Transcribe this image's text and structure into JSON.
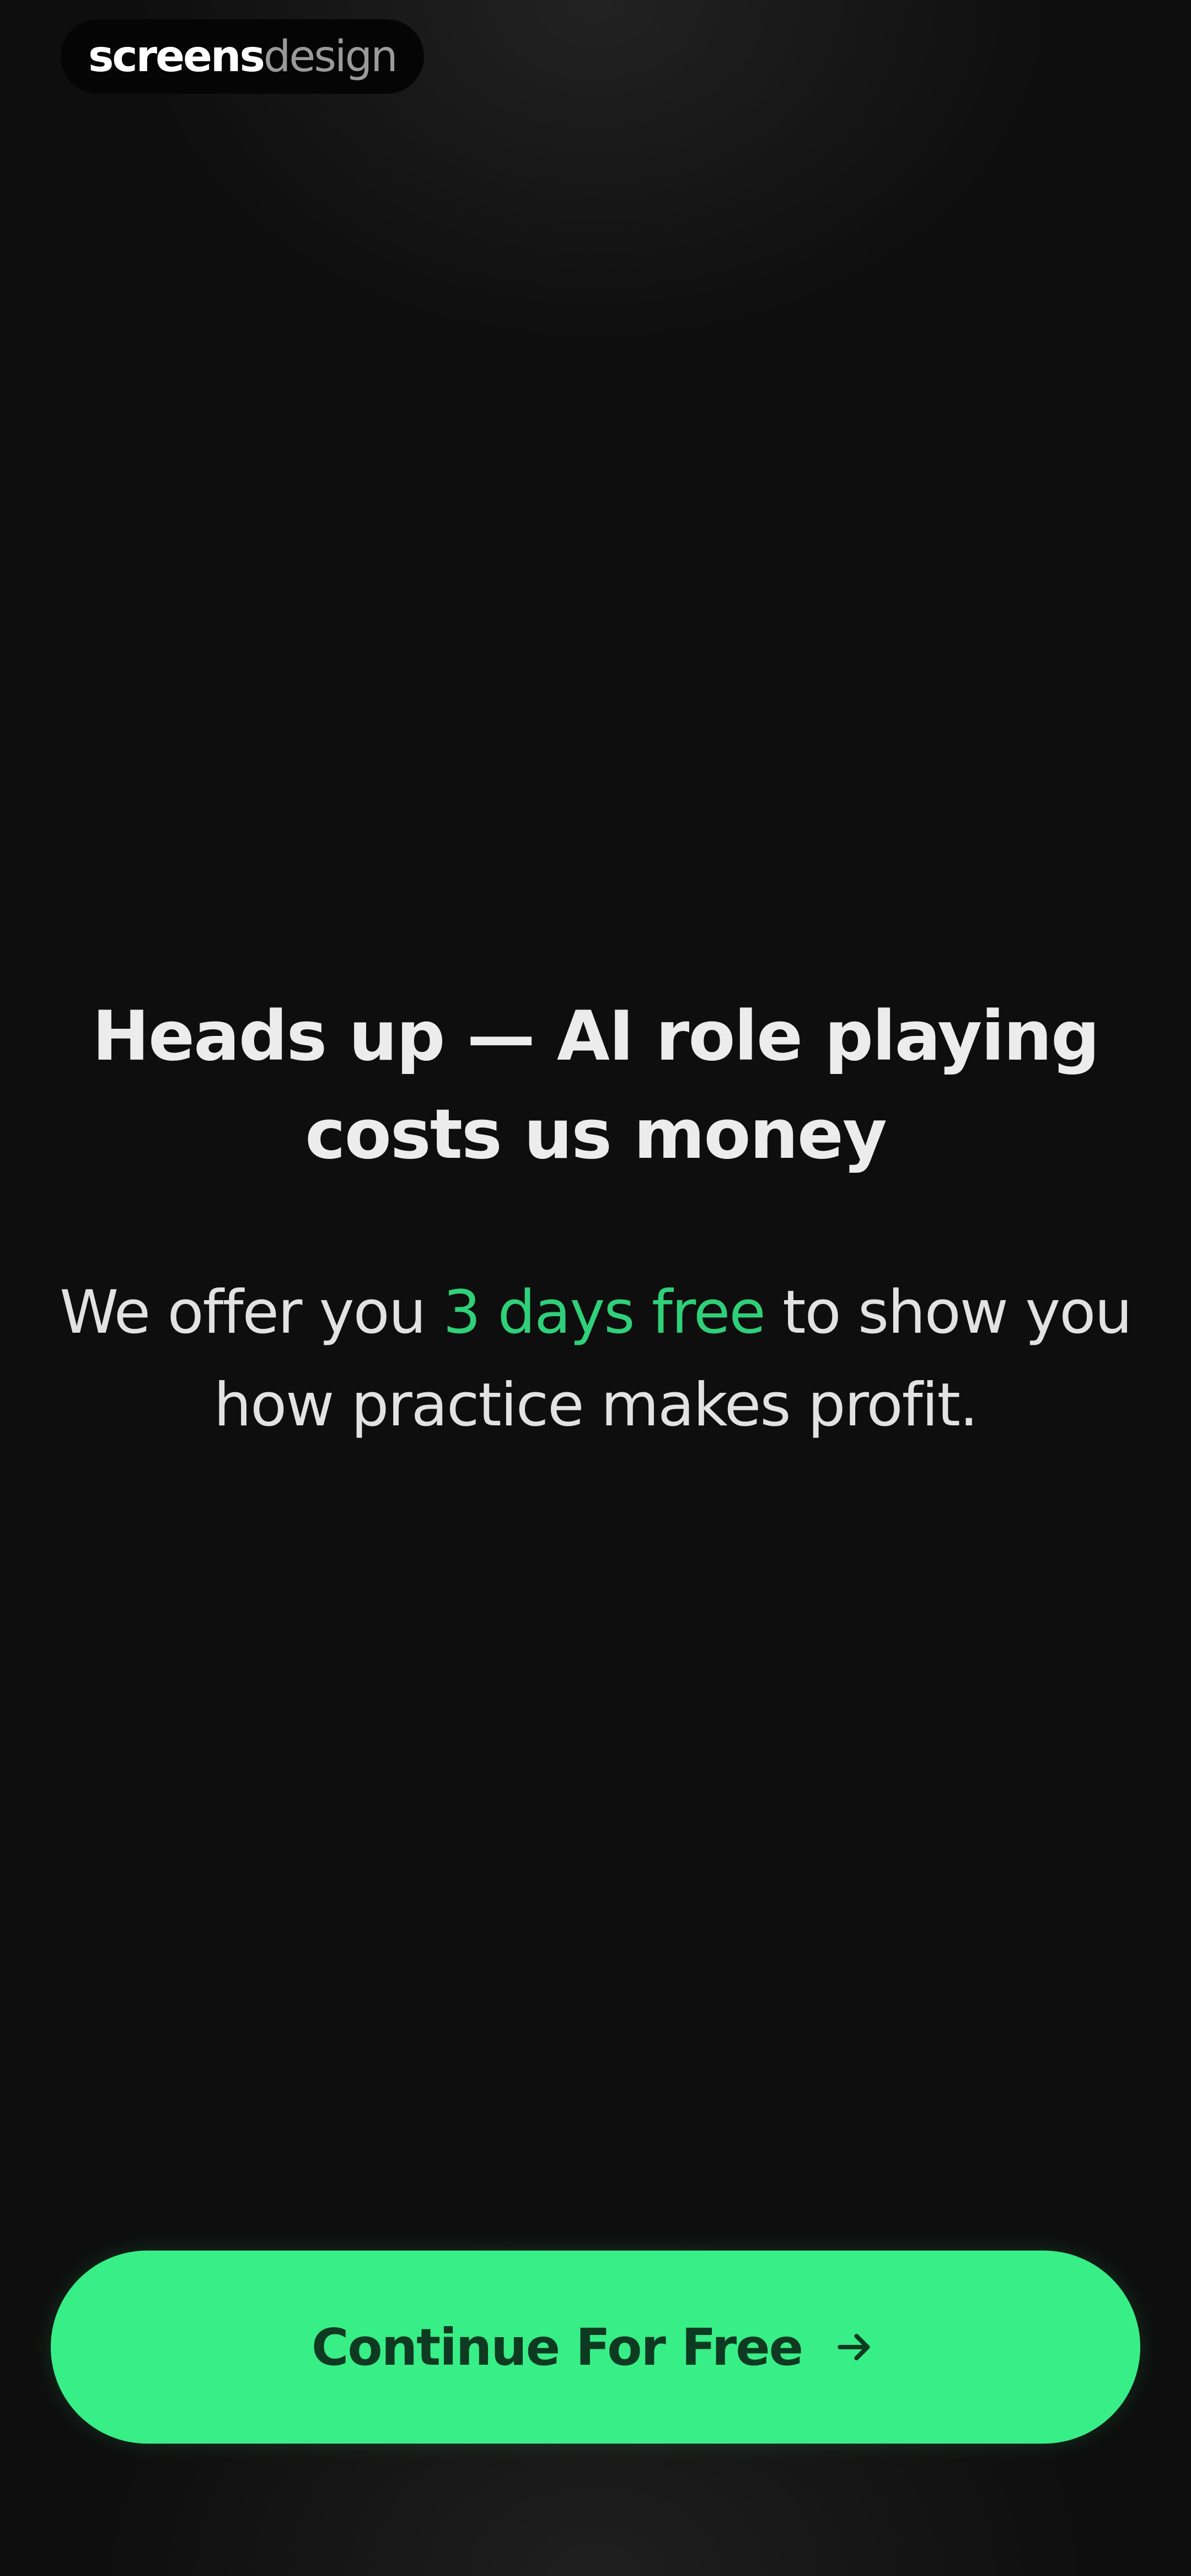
{
  "watermark": {
    "strong": "screens",
    "light": "design"
  },
  "headline": {
    "title": "Heads up — AI role playing costs us money"
  },
  "subtext": {
    "before": "We offer you ",
    "highlight": "3 days free",
    "after": " to show you how practice makes profit."
  },
  "cta": {
    "label": "Continue For Free",
    "icon": "arrow-right-icon"
  },
  "colors": {
    "accent": "#38ee86",
    "highlight_text": "#2fd079",
    "background": "#0e0e0e",
    "cta_text": "#0f3a22"
  }
}
